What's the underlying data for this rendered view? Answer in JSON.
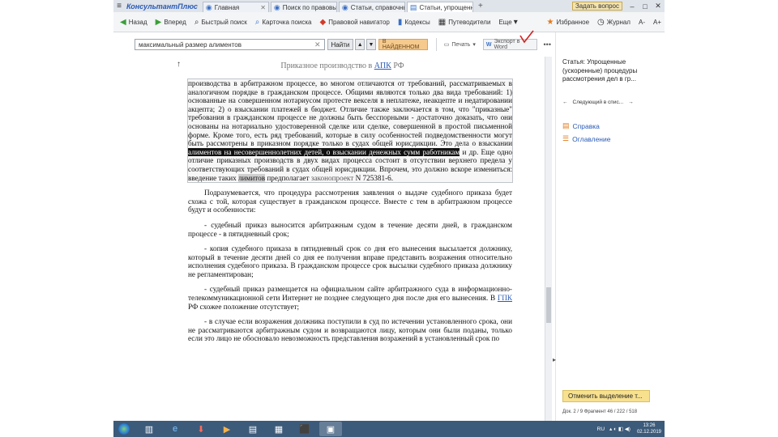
{
  "app": {
    "brand": "КонсультантПлюс"
  },
  "tabs": [
    {
      "label": "Главная",
      "active": false
    },
    {
      "label": "Поиск по правовым",
      "active": false
    },
    {
      "label": "Статьи, справочные",
      "active": false
    },
    {
      "label": "Статьи, упрощенные",
      "active": true
    }
  ],
  "titlebar": {
    "ask_label": "Задать вопрос",
    "window_controls": [
      "–",
      "□",
      "✕"
    ]
  },
  "toolbar": {
    "back": "Назад",
    "forward": "Вперед",
    "items": [
      "Быстрый поиск",
      "Карточка поиска",
      "Правовой навигатор",
      "Кодексы",
      "Путеводители",
      "Еще"
    ],
    "right_items": [
      "Избранное",
      "Журнал"
    ],
    "font_smaller": "A-",
    "font_larger": "A+"
  },
  "search": {
    "value": "максимальный размер алиментов",
    "clear_icon": "✕",
    "find_label": "Найти",
    "in_list_label": "В НАЙДЕННОМ",
    "print_label": "Печать",
    "word_label": "Экспорт в Word",
    "more_label": "•••"
  },
  "document": {
    "title_prefix": "Приказное производство в",
    "title_link": "АПК",
    "title_suffix": "РФ",
    "p1_lead": "производства в арбитражном процессе, во многом отличаются от требований, рассматриваемых в аналогичном порядке в гражданском процессе. Общими являются только два вида требований: 1) основанные на совершенном нотариусом протесте векселя в неплатеже, неакцепте и недатировании акцепта; 2) о взыскании платежей в бюджет. Отличие также заключается в том, что \"приказные\" требования в гражданском процессе не должны быть бесспорными - достаточно доказать, что они основаны на нотариально удостоверенной сделке или сделке, совершенной в простой письменной форме. Кроме того, есть ряд требований, которые в силу особенностей подведомственности могут быть рассмотрены в приказном порядке только в судах общей юрисдикции. Это дела о взыскании",
    "p1_highlight": "алиментов на несовершеннолетних детей, о взыскании денежных сумм работникам",
    "p1_mid": "и др. Еще одно отличие приказных производств в двух видах процесса состоит в отсутствии верхнего предела у соответствующих требований в судах общей юрисдикции. Впрочем, это должно вскоре измениться: введение таких",
    "p1_grey": "лимитов",
    "p1_tail_a": "предполагает",
    "p1_tail_ref": "законопроект",
    "p1_tail_b": "N 725381-6.",
    "p2": "Подразумевается, что процедура рассмотрения заявления о выдаче судебного приказа будет схожа с той, которая существует в гражданском процессе. Вместе с тем в арбитражном процессе будут и особенности:",
    "p3": "- судебный приказ выносится арбитражным судом в течение десяти дней, в гражданском процессе - в пятидневный срок;",
    "p4": "- копия судебного приказа в пятидневный срок со дня его вынесения высылается должнику, который в течение десяти дней со дня ее получения вправе представить возражения относительно исполнения судебного приказа. В гражданском процессе срок высылки судебного приказа должнику не регламентирован;",
    "p5_a": "- судебный приказ размещается на официальном сайте арбитражного суда в информационно-телекоммуникационной сети Интернет не позднее следующего дня после дня его вынесения. В",
    "p5_link": "ГПК",
    "p5_b": "РФ схожее положение отсутствует;",
    "p6": "- в случае если возражения должника поступили в суд по истечении установленного срока, они не рассматриваются арбитражным судом и возвращаются лицу, которым они были поданы, только если это лицо не обосновало невозможность представления возражений в установленный срок по"
  },
  "right_panel": {
    "title": "Статья: Упрощенные (ускоренные) процедуры рассмотрения дел в гр...",
    "nav_label": "Следующий в спис...",
    "links": [
      "Справка",
      "Оглавление"
    ],
    "cancel_label": "Отменить выделение т...",
    "status": "Док. 2 / 9 Фрагмент 46 / 222 / 518"
  },
  "taskbar": {
    "lang": "RU",
    "time": "13:26",
    "date": "02.12.2019"
  }
}
